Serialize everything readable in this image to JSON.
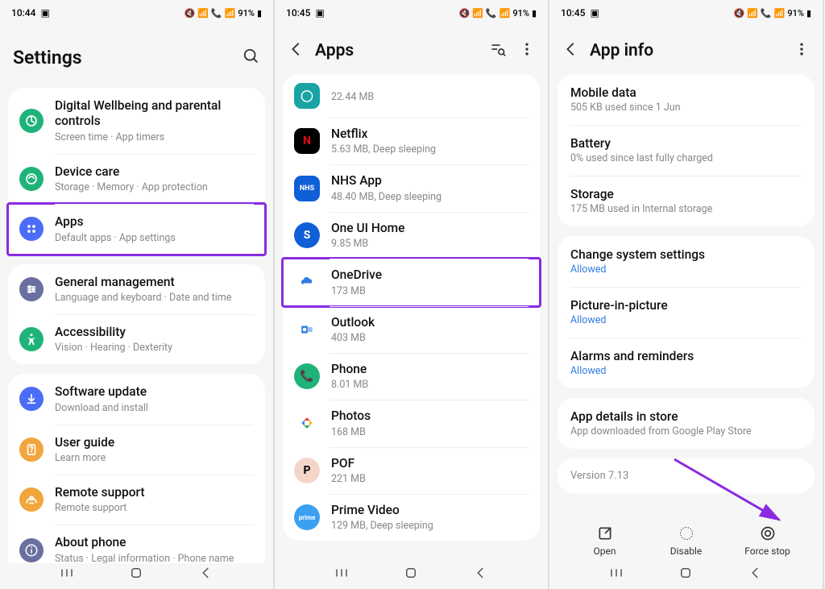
{
  "status": {
    "time1": "10:44",
    "time2": "10:45",
    "time3": "10:45",
    "battery": "91%"
  },
  "screen1": {
    "title": "Settings",
    "groups": [
      [
        {
          "icon": "wellbeing",
          "bg": "#1fb37a",
          "title": "Digital Wellbeing and parental controls",
          "sub": "Screen time  ·  App timers"
        },
        {
          "icon": "care",
          "bg": "#1fb37a",
          "title": "Device care",
          "sub": "Storage  ·  Memory  ·  App protection"
        },
        {
          "icon": "apps",
          "bg": "#4a6cf7",
          "title": "Apps",
          "sub": "Default apps  ·  App settings",
          "highlight": true
        }
      ],
      [
        {
          "icon": "general",
          "bg": "#6b6fa0",
          "title": "General management",
          "sub": "Language and keyboard  ·  Date and time"
        },
        {
          "icon": "access",
          "bg": "#1fb37a",
          "title": "Accessibility",
          "sub": "Vision  ·  Hearing  ·  Dexterity"
        }
      ],
      [
        {
          "icon": "update",
          "bg": "#4a6cf7",
          "title": "Software update",
          "sub": "Download and install"
        },
        {
          "icon": "guide",
          "bg": "#f0a63c",
          "title": "User guide",
          "sub": "Learn more"
        },
        {
          "icon": "remote",
          "bg": "#f0a63c",
          "title": "Remote support",
          "sub": "Remote support"
        },
        {
          "icon": "about",
          "bg": "#6b6fa0",
          "title": "About phone",
          "sub": "Status  ·  Legal information  ·  Phone name"
        }
      ]
    ]
  },
  "screen2": {
    "title": "Apps",
    "apps": [
      {
        "bg": "#1aa3a3",
        "name": "",
        "sub": "22.44 MB",
        "glyph": "◯"
      },
      {
        "bg": "#000",
        "name": "Netflix",
        "sub": "5.63 MB, Deep sleeping",
        "color": "#e50914",
        "glyph": "N"
      },
      {
        "bg": "#0f5fd6",
        "name": "NHS App",
        "sub": "48.40 MB, Deep sleeping",
        "glyph": "NHS",
        "fs": "9px"
      },
      {
        "bg": "#0f5fd6",
        "name": "One UI Home",
        "sub": "9.85 MB",
        "glyph": "S",
        "shape": "circle"
      },
      {
        "bg": "#fff",
        "name": "OneDrive",
        "sub": "173 MB",
        "cloud": true,
        "highlight": true
      },
      {
        "bg": "#fff",
        "name": "Outlook",
        "sub": "403 MB",
        "outlook": true
      },
      {
        "bg": "#1fb37a",
        "name": "Phone",
        "sub": "8.01 MB",
        "glyph": "📞",
        "shape": "circle"
      },
      {
        "bg": "#fff",
        "name": "Photos",
        "sub": "168 MB",
        "photos": true
      },
      {
        "bg": "#f4d6c9",
        "name": "POF",
        "sub": "221 MB",
        "glyph": "P",
        "color": "#000",
        "shape": "circle"
      },
      {
        "bg": "#3aa0f2",
        "name": "Prime Video",
        "sub": "129 MB, Deep sleeping",
        "glyph": "prime",
        "fs": "8px",
        "shape": "circle"
      }
    ]
  },
  "screen3": {
    "title": "App info",
    "sections": [
      [
        {
          "title": "Mobile data",
          "sub": "505 KB used since 1 Jun"
        },
        {
          "title": "Battery",
          "sub": "0% used since last fully charged"
        },
        {
          "title": "Storage",
          "sub": "175 MB used in Internal storage"
        }
      ],
      [
        {
          "title": "Change system settings",
          "sub": "Allowed",
          "link": true
        },
        {
          "title": "Picture-in-picture",
          "sub": "Allowed",
          "link": true
        },
        {
          "title": "Alarms and reminders",
          "sub": "Allowed",
          "link": true
        }
      ],
      [
        {
          "title": "App details in store",
          "sub": "App downloaded from Google Play Store"
        }
      ],
      [
        {
          "title": "Version 7.13",
          "noSub": true
        }
      ]
    ],
    "actions": {
      "open": "Open",
      "disable": "Disable",
      "force": "Force stop"
    }
  }
}
